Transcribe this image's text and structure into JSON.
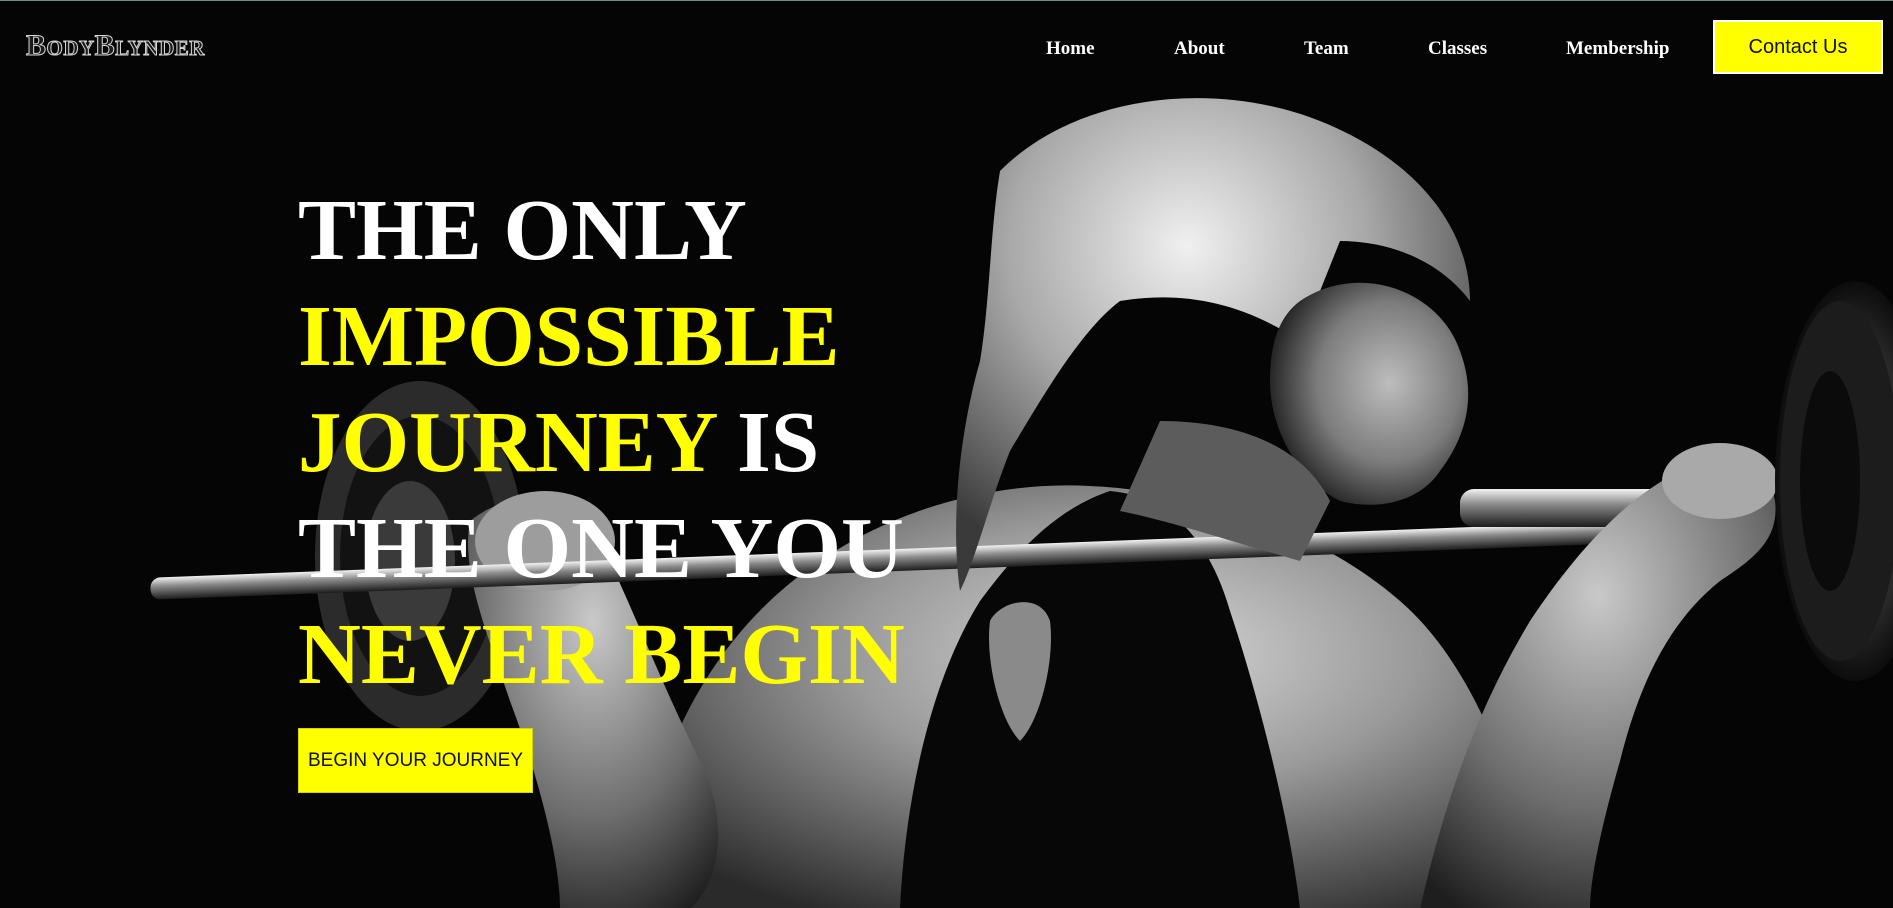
{
  "brand": {
    "logo_text": "BodyBlynder"
  },
  "nav": {
    "items": [
      {
        "label": "Home"
      },
      {
        "label": "About"
      },
      {
        "label": "Team"
      },
      {
        "label": "Classes"
      },
      {
        "label": "Membership"
      }
    ],
    "contact_label": "Contact Us"
  },
  "hero": {
    "headline": {
      "line1": "THE ONLY",
      "line2": "IMPOSSIBLE",
      "line3_yellow": "JOURNEY",
      "line3_white": " IS",
      "line4": "THE ONE YOU",
      "line5": "NEVER BEGIN"
    },
    "cta_label": "BEGIN YOUR JOURNEY",
    "image_subject": "woman-lifting-barbell-photo"
  },
  "colors": {
    "accent": "#ffff00",
    "background": "#000000",
    "text": "#ffffff"
  }
}
